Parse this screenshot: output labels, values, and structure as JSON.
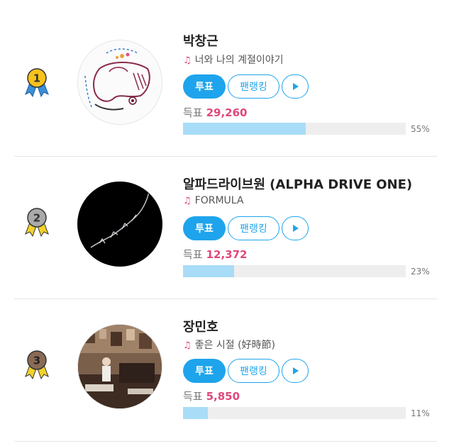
{
  "labels": {
    "vote": "투표",
    "rank": "팬랭킹",
    "votes_prefix": "득표"
  },
  "colors": {
    "accent": "#1ea4ec",
    "highlight": "#e0487a",
    "bar_fill": "#a8dcf7",
    "bar_track": "#eeeeee"
  },
  "entries": [
    {
      "rank": "1",
      "artist": "박창근",
      "song": "너와 나의 계절이야기",
      "votes": "29,260",
      "percent_label": "55%",
      "percent": 55,
      "medal_color": "#f6c21c",
      "ribbon_color": "#3a8fd8",
      "cover_icon": "illustrated-album-cover"
    },
    {
      "rank": "2",
      "artist": "알파드라이브원 (ALPHA DRIVE ONE)",
      "song": "FORMULA",
      "votes": "12,372",
      "percent_label": "23%",
      "percent": 23,
      "medal_color": "#a9a9a9",
      "ribbon_color": "#f2d22a",
      "cover_icon": "black-album-cover"
    },
    {
      "rank": "3",
      "artist": "장민호",
      "song": "좋은 시절 (好時節)",
      "votes": "5,850",
      "percent_label": "11%",
      "percent": 11,
      "medal_color": "#8a6a55",
      "ribbon_color": "#f2d22a",
      "cover_icon": "photo-album-cover"
    }
  ]
}
